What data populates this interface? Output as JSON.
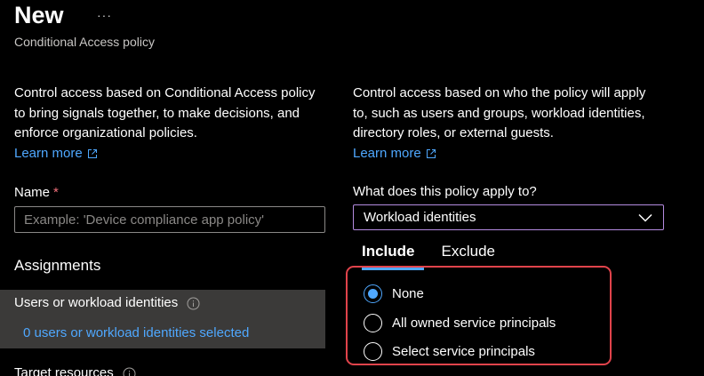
{
  "header": {
    "title": "New",
    "more_label": "···",
    "subtitle": "Conditional Access policy"
  },
  "left": {
    "description": "Control access based on Conditional Access policy to bring signals together, to make decisions, and enforce organizational policies.",
    "learn_more": "Learn more",
    "name_label": "Name",
    "required_mark": "*",
    "name_placeholder": "Example: 'Device compliance app policy'",
    "assignments_heading": "Assignments",
    "users_title": "Users or workload identities",
    "users_link": "0 users or workload identities selected",
    "target_resources": "Target resources"
  },
  "right": {
    "description": "Control access based on who the policy will apply to, such as users and groups, workload identities, directory roles, or external guests.",
    "learn_more": "Learn more",
    "apply_label": "What does this policy apply to?",
    "apply_selected": "Workload identities",
    "tabs": [
      {
        "label": "Include",
        "active": true
      },
      {
        "label": "Exclude",
        "active": false
      }
    ],
    "options": [
      {
        "label": "None",
        "checked": true
      },
      {
        "label": "All owned service principals",
        "checked": false
      },
      {
        "label": "Select service principals",
        "checked": false
      }
    ]
  },
  "colors": {
    "background": "#000000",
    "link": "#4fa8ff",
    "highlight": "#e0434b",
    "dropdown_border": "#b48be0",
    "panel": "#3b3a39"
  },
  "icons": [
    "more-icon",
    "external-link-icon",
    "info-icon",
    "chevron-down-icon",
    "radio-icon"
  ]
}
